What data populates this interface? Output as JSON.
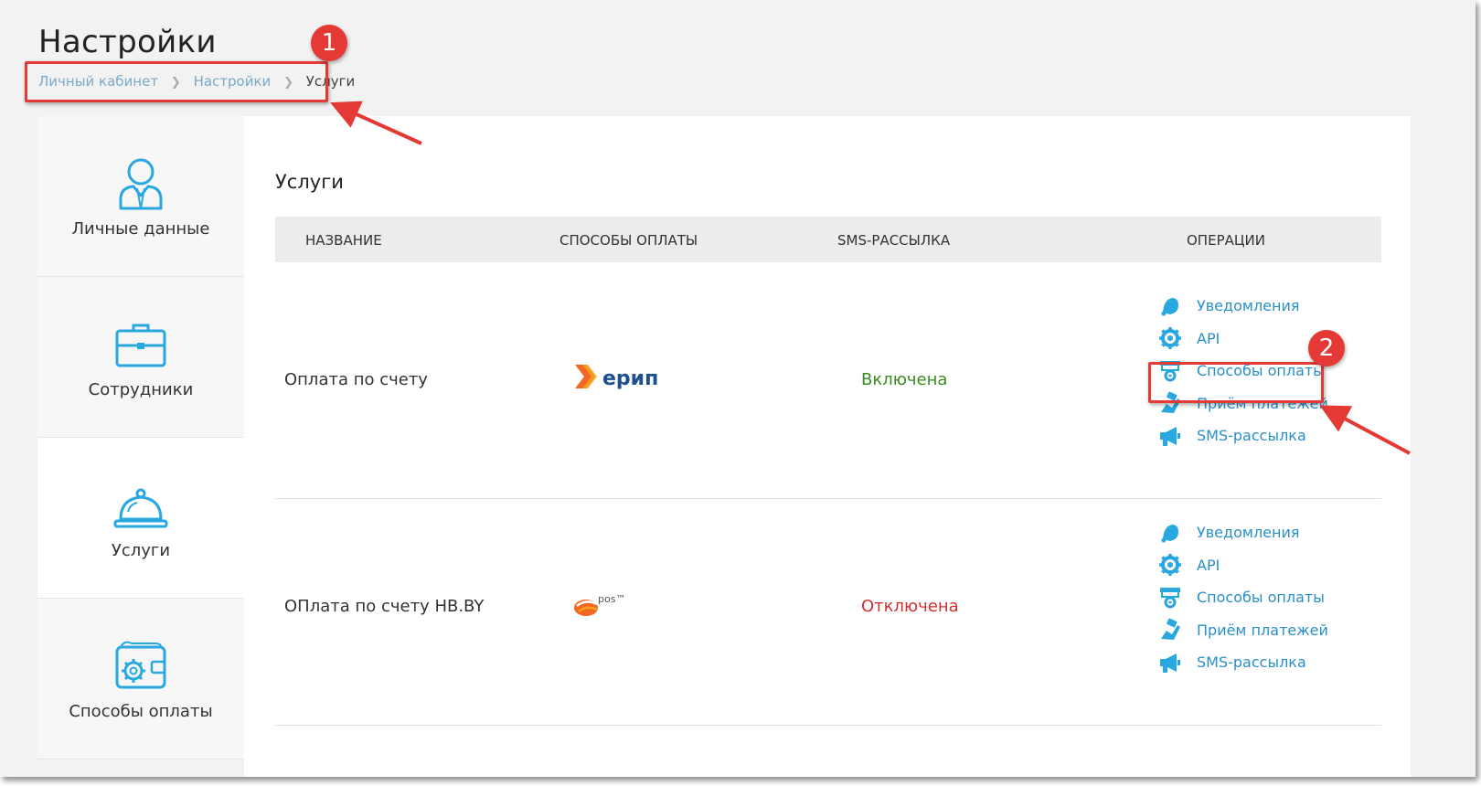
{
  "page": {
    "title": "Настройки",
    "breadcrumb": [
      "Личный кабинет",
      "Настройки",
      "Услуги"
    ]
  },
  "sidebar": {
    "items": [
      {
        "label": "Личные данные",
        "icon": "user-icon",
        "active": false
      },
      {
        "label": "Сотрудники",
        "icon": "briefcase-icon",
        "active": false
      },
      {
        "label": "Услуги",
        "icon": "service-bell-icon",
        "active": true
      },
      {
        "label": "Способы оплаты",
        "icon": "wallet-gear-icon",
        "active": false
      }
    ]
  },
  "main": {
    "section_title": "Услуги",
    "columns": [
      "НАЗВАНИЕ",
      "СПОСОБЫ ОПЛАТЫ",
      "SMS-РАССЫЛКА",
      "ОПЕРАЦИИ"
    ],
    "rows": [
      {
        "name": "Оплата по счету",
        "payment_logo": "ерип",
        "sms_status": "Включена",
        "sms_color": "#3a8a1f",
        "operations": [
          "Уведомления",
          "API",
          "Способы оплаты",
          "Приём платежей",
          "SMS-рассылка"
        ]
      },
      {
        "name": "ОПлата по счету НВ.BY",
        "payment_logo": "pos™",
        "sms_status": "Отключена",
        "sms_color": "#d32f2f",
        "operations": [
          "Уведомления",
          "API",
          "Способы оплаты",
          "Приём платежей",
          "SMS-рассылка"
        ]
      }
    ]
  },
  "annotations": [
    "1",
    "2"
  ],
  "colors": {
    "accent": "#2a8fc6",
    "icon_blue": "#29a8df",
    "annotation_red": "#e53935",
    "erip_orange": "#f26722",
    "erip_blue": "#1d4f91"
  }
}
